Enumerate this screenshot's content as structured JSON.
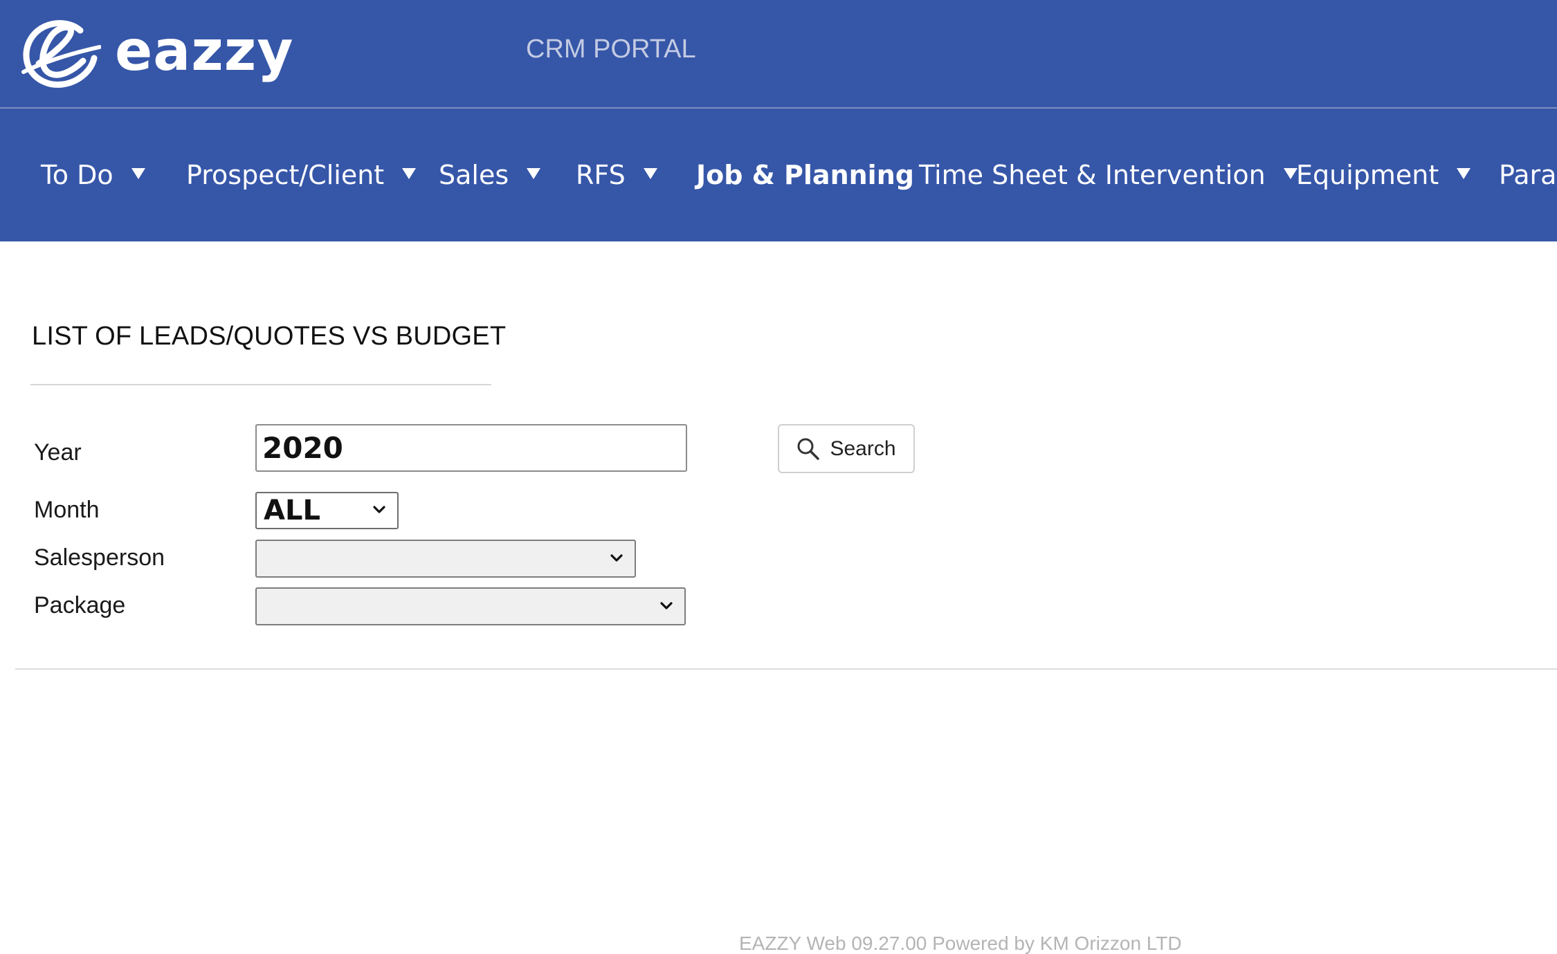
{
  "brand": {
    "name": "eazzy",
    "portal_title": "CRM PORTAL",
    "logo_icon": "eazzy-e-swirl-icon"
  },
  "colors": {
    "header_bg": "#3656a8",
    "nav_text": "#ffffff",
    "portal_title": "#c3cbe3",
    "footer_text": "#b4b4b4"
  },
  "nav": {
    "items": [
      {
        "label": "To Do",
        "has_dropdown": true
      },
      {
        "label": "Prospect/Client",
        "has_dropdown": true
      },
      {
        "label": "Sales",
        "has_dropdown": true
      },
      {
        "label": "RFS",
        "has_dropdown": true
      },
      {
        "label": "Job & Planning",
        "has_dropdown": false,
        "active": true
      },
      {
        "label": "Time Sheet & Intervention",
        "has_dropdown": true
      },
      {
        "label": "Equipment",
        "has_dropdown": true
      },
      {
        "label": "Param",
        "has_dropdown": false
      }
    ]
  },
  "page": {
    "title": "LIST OF LEADS/QUOTES VS BUDGET"
  },
  "form": {
    "year": {
      "label": "Year",
      "value": "2020"
    },
    "month": {
      "label": "Month",
      "value": "ALL"
    },
    "salesperson": {
      "label": "Salesperson",
      "value": ""
    },
    "package": {
      "label": "Package",
      "value": ""
    },
    "search_button": {
      "label": "Search",
      "icon": "search-icon"
    }
  },
  "footer": {
    "text": "EAZZY Web 09.27.00  Powered by KM Orizzon LTD"
  }
}
